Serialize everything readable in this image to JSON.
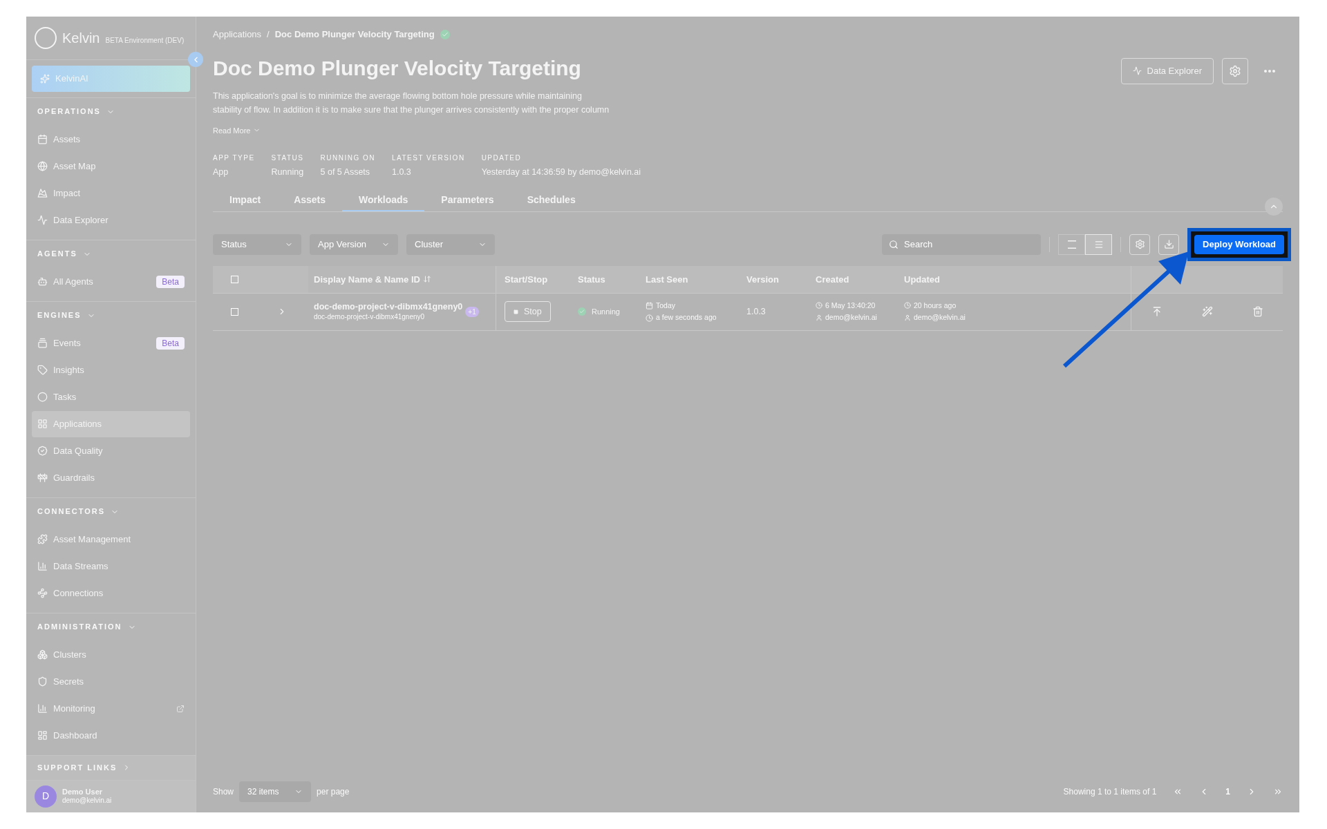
{
  "sidebar": {
    "logo": "Kelvin",
    "environment": "BETA Environment (DEV)",
    "ai_button": "KelvinAI",
    "sections": [
      {
        "title": "OPERATIONS",
        "expanded": true,
        "items": [
          {
            "label": "Assets",
            "selected": false
          },
          {
            "label": "Asset Map",
            "selected": false
          },
          {
            "label": "Impact",
            "selected": false
          },
          {
            "label": "Data Explorer",
            "selected": false
          }
        ]
      },
      {
        "title": "AGENTS",
        "expanded": true,
        "items": [
          {
            "label": "All Agents",
            "selected": false,
            "badge": "Beta"
          }
        ]
      },
      {
        "title": "ENGINES",
        "expanded": true,
        "items": [
          {
            "label": "Events",
            "selected": false,
            "badge": "Beta"
          },
          {
            "label": "Insights",
            "selected": false
          },
          {
            "label": "Tasks",
            "selected": false
          },
          {
            "label": "Applications",
            "selected": true
          },
          {
            "label": "Data Quality",
            "selected": false
          },
          {
            "label": "Guardrails",
            "selected": false
          }
        ]
      },
      {
        "title": "CONNECTORS",
        "expanded": true,
        "items": [
          {
            "label": "Asset Management",
            "selected": false
          },
          {
            "label": "Data Streams",
            "selected": false
          },
          {
            "label": "Connections",
            "selected": false
          }
        ]
      },
      {
        "title": "ADMINISTRATION",
        "expanded": true,
        "items": [
          {
            "label": "Clusters",
            "selected": false
          },
          {
            "label": "Secrets",
            "selected": false
          },
          {
            "label": "Monitoring",
            "selected": false,
            "external": true
          },
          {
            "label": "Dashboard",
            "selected": false
          }
        ]
      }
    ],
    "support_links": {
      "title": "SUPPORT LINKS",
      "expanded": false
    },
    "user": {
      "initial": "D",
      "name": "Demo User",
      "email": "demo@kelvin.ai"
    }
  },
  "breadcrumb": [
    "Applications",
    "Doc Demo Plunger Velocity Targeting"
  ],
  "breadcrumb_separator": "/",
  "title": "Doc Demo Plunger Velocity Targeting",
  "description": [
    "This application's goal is to minimize the average flowing bottom hole pressure while maintaining",
    "stability of flow. In addition it is to make sure that the plunger arrives consistently with the proper column"
  ],
  "read_more": "Read More",
  "header_buttons": {
    "data_explorer": "Data Explorer"
  },
  "meta": [
    {
      "label": "APP TYPE",
      "value": "App"
    },
    {
      "label": "STATUS",
      "value": "Running"
    },
    {
      "label": "RUNNING ON",
      "value": "5 of 5 Assets"
    },
    {
      "label": "LATEST VERSION",
      "value": "1.0.3"
    },
    {
      "label": "UPDATED",
      "value": "Yesterday at 14:36:59 by demo@kelvin.ai"
    }
  ],
  "tabs": [
    {
      "label": "Impact",
      "selected": false
    },
    {
      "label": "Assets",
      "selected": false
    },
    {
      "label": "Workloads",
      "selected": true
    },
    {
      "label": "Parameters",
      "selected": false
    },
    {
      "label": "Schedules",
      "selected": false
    }
  ],
  "filters": [
    "Status",
    "App Version",
    "Cluster"
  ],
  "search": {
    "placeholder": "Search"
  },
  "view_toggle": [
    {
      "selected": false
    },
    {
      "selected": true
    }
  ],
  "deploy_button": "Deploy Workload",
  "table": {
    "select_all": {
      "checked": false
    },
    "columns": [
      "Display Name & Name ID",
      "Start/Stop",
      "Status",
      "Last Seen",
      "Version",
      "Created",
      "Updated"
    ],
    "rows": [
      {
        "checked": false,
        "name": "doc-demo-project-v-dibmx41gneny0",
        "name_id": "doc-demo-project-v-dibmx41gneny0",
        "extra": "+1",
        "action": "Stop",
        "status": "Running",
        "last_seen_date": "Today",
        "last_seen_time": "a few seconds ago",
        "version": "1.0.3",
        "created_time": "6 May 13:40:20",
        "created_by": "demo@kelvin.ai",
        "updated_time": "20 hours ago",
        "updated_by": "demo@kelvin.ai"
      }
    ]
  },
  "footer": {
    "show": "Show",
    "page_size": "32 items",
    "per_page": "per page",
    "summary": "Showing 1 to 1 items of 1",
    "current_page": "1"
  }
}
